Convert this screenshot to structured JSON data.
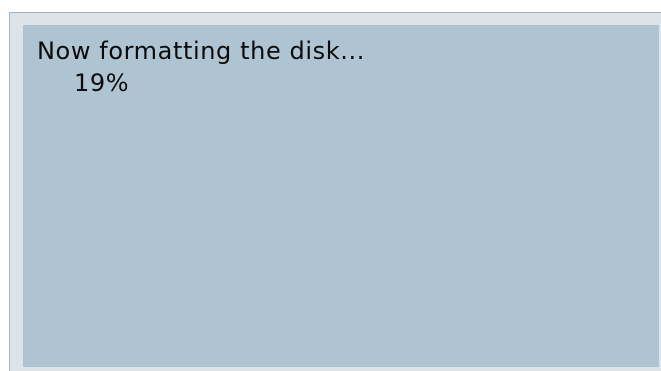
{
  "dialog": {
    "message": "Now formatting the disk...",
    "progress_label": "19%",
    "progress_value": 0.19
  },
  "colors": {
    "frame": "#dde4e9",
    "screen": "#afc4d2",
    "text": "#0b0b0b"
  }
}
